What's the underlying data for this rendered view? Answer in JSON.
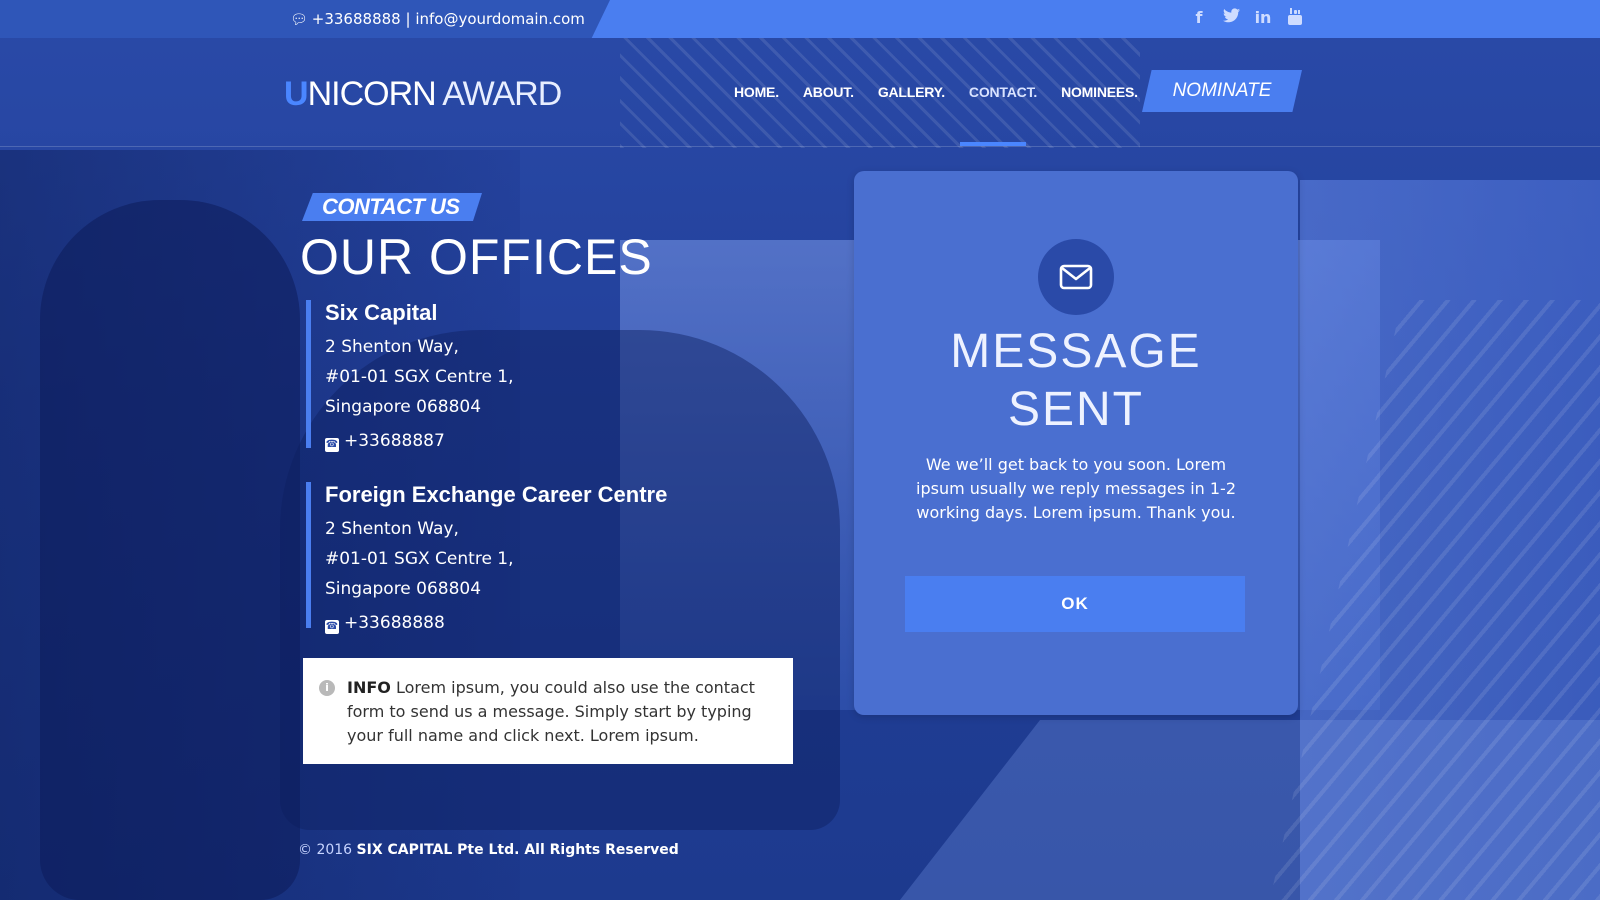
{
  "topbar": {
    "phone": "+33688888",
    "separator": "|",
    "email": "info@yourdomain.com",
    "social_icons": [
      "facebook-icon",
      "twitter-icon",
      "linkedin-icon",
      "youtube-icon"
    ]
  },
  "header": {
    "logo_u": "U",
    "logo_bold": "NICORN",
    "logo_light": " AWARD",
    "nav": [
      "HOME.",
      "ABOUT.",
      "GALLERY.",
      "CONTACT.",
      "NOMINEES."
    ],
    "active_nav": "CONTACT.",
    "nominate_label": "NOMINATE"
  },
  "contact": {
    "tag": "CONTACT US",
    "title": "OUR OFFICES",
    "offices": [
      {
        "name": "Six Capital",
        "lines": [
          "2 Shenton Way,",
          "#01-01 SGX Centre 1,",
          "Singapore 068804"
        ],
        "phone": "+33688887"
      },
      {
        "name": "Foreign Exchange Career Centre",
        "lines": [
          "2 Shenton Way,",
          "#01-01 SGX Centre 1,",
          "Singapore 068804"
        ],
        "phone": "+33688888"
      }
    ],
    "info_label": "INFO",
    "info_text": " Lorem ipsum, you could also use the contact form to send us a message. Simply start by typing your full name and click next. Lorem ipsum."
  },
  "modal": {
    "title_line1": "MESSAGE",
    "title_line2": "SENT",
    "body": "We we’ll get back to you soon. Lorem ipsum usually we reply messages in 1-2 working days. Lorem ipsum. Thank you.",
    "ok_label": "OK"
  },
  "footer": {
    "copyright": "© 2016 ",
    "company": "SIX CAPITAL Pte Ltd. All Rights Reserved"
  },
  "colors": {
    "accent": "#4a7ef0",
    "background": "#22409a",
    "card": "#4a6fd0"
  }
}
